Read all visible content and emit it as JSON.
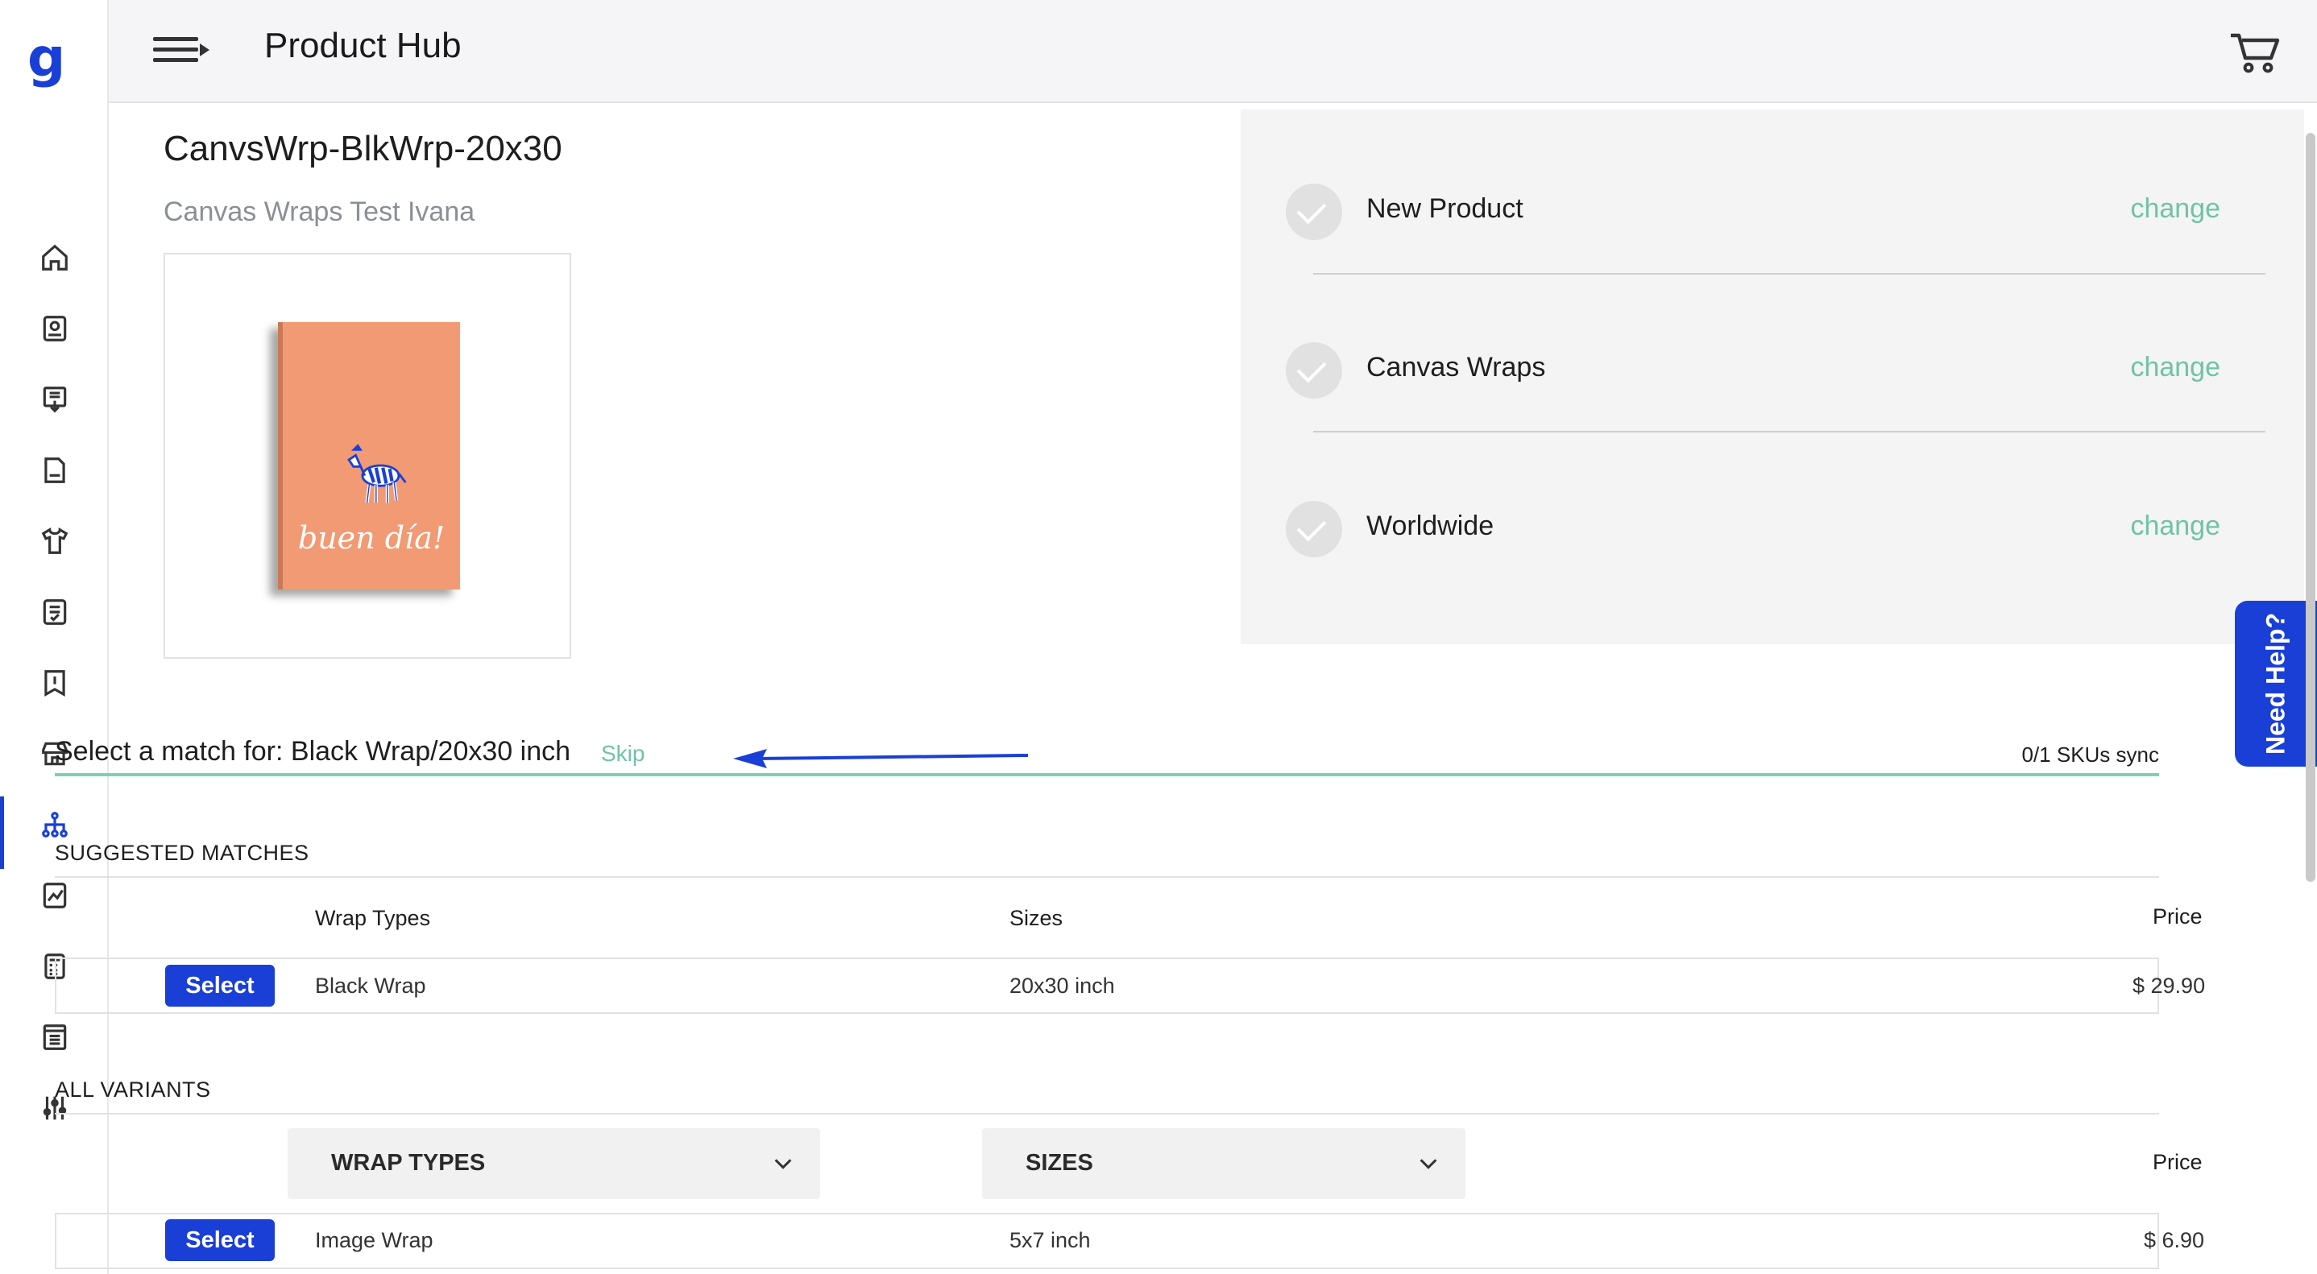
{
  "app": {
    "logo_letter": "g",
    "title": "Product Hub"
  },
  "product": {
    "name": "CanvsWrp-BlkWrp-20x30",
    "subtitle": "Canvas Wraps Test Ivana",
    "image_text": "buen día!"
  },
  "steps": [
    {
      "label": "New Product",
      "action": "change"
    },
    {
      "label": "Canvas Wraps",
      "action": "change"
    },
    {
      "label": "Worldwide",
      "action": "change"
    }
  ],
  "need_help": "Need Help?",
  "match": {
    "label": "Select a match for: Black Wrap/20x30 inch",
    "skip": "Skip",
    "sku_status": "0/1 SKUs sync"
  },
  "suggested": {
    "title": "SUGGESTED MATCHES",
    "headers": {
      "wrap": "Wrap Types",
      "size": "Sizes",
      "price": "Price"
    },
    "rows": [
      {
        "button": "Select",
        "wrap": "Black Wrap",
        "size": "20x30 inch",
        "price": "$ 29.90"
      }
    ]
  },
  "all_variants": {
    "title": "ALL VARIANTS",
    "filters": {
      "wrap": "WRAP TYPES",
      "size": "SIZES"
    },
    "price_header": "Price",
    "rows": [
      {
        "button": "Select",
        "wrap": "Image Wrap",
        "size": "5x7 inch",
        "price": "$ 6.90"
      }
    ]
  },
  "colors": {
    "brand": "#1a3fd6",
    "accent": "#6fc3a6"
  }
}
